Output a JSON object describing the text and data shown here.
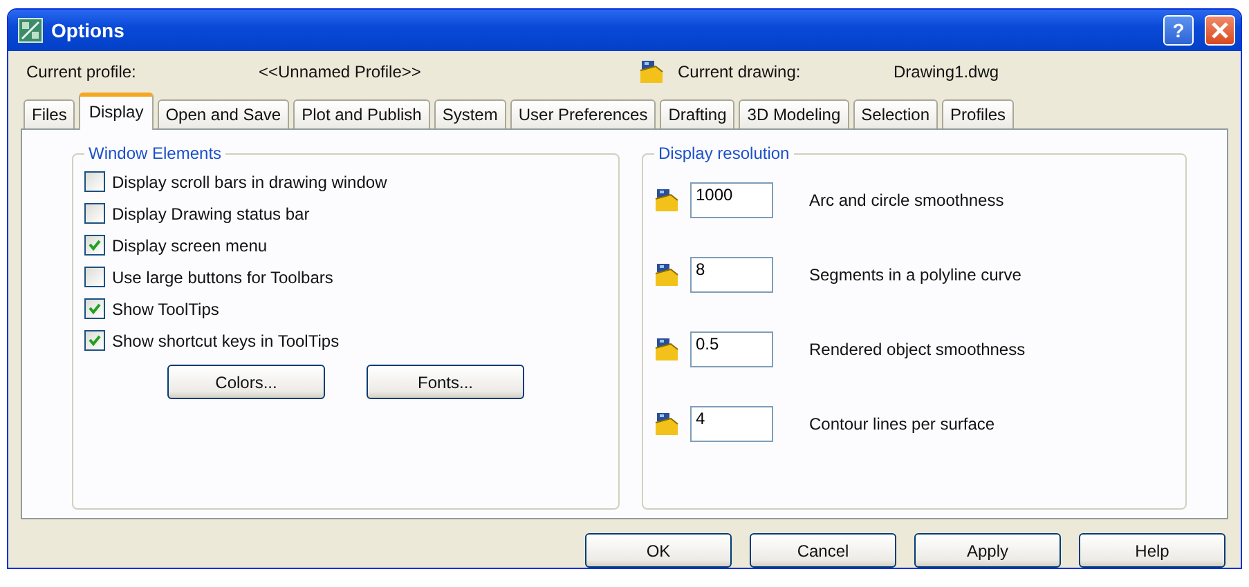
{
  "window": {
    "title": "Options",
    "help_button": "?"
  },
  "profile": {
    "label": "Current profile:",
    "value": "<<Unnamed Profile>>"
  },
  "drawing": {
    "label": "Current drawing:",
    "value": "Drawing1.dwg"
  },
  "tabs": [
    {
      "label": "Files",
      "selected": false
    },
    {
      "label": "Display",
      "selected": true
    },
    {
      "label": "Open and Save",
      "selected": false
    },
    {
      "label": "Plot and Publish",
      "selected": false
    },
    {
      "label": "System",
      "selected": false
    },
    {
      "label": "User Preferences",
      "selected": false
    },
    {
      "label": "Drafting",
      "selected": false
    },
    {
      "label": "3D Modeling",
      "selected": false
    },
    {
      "label": "Selection",
      "selected": false
    },
    {
      "label": "Profiles",
      "selected": false
    }
  ],
  "window_elements": {
    "title": "Window Elements",
    "checkboxes": [
      {
        "label": "Display scroll bars in drawing window",
        "checked": false
      },
      {
        "label": "Display Drawing status bar",
        "checked": false
      },
      {
        "label": "Display screen menu",
        "checked": true
      },
      {
        "label": "Use large buttons for Toolbars",
        "checked": false
      },
      {
        "label": "Show ToolTips",
        "checked": true
      },
      {
        "label": "Show shortcut keys in ToolTips",
        "checked": true
      }
    ],
    "buttons": [
      "Colors...",
      "Fonts..."
    ]
  },
  "display_resolution": {
    "title": "Display resolution",
    "settings": [
      {
        "value": "1000",
        "label": "Arc and circle smoothness"
      },
      {
        "value": "8",
        "label": "Segments in a polyline curve"
      },
      {
        "value": "0.5",
        "label": "Rendered object smoothness"
      },
      {
        "value": "4",
        "label": "Contour lines per surface"
      }
    ]
  },
  "buttons": [
    "OK",
    "Cancel",
    "Apply",
    "Help"
  ]
}
